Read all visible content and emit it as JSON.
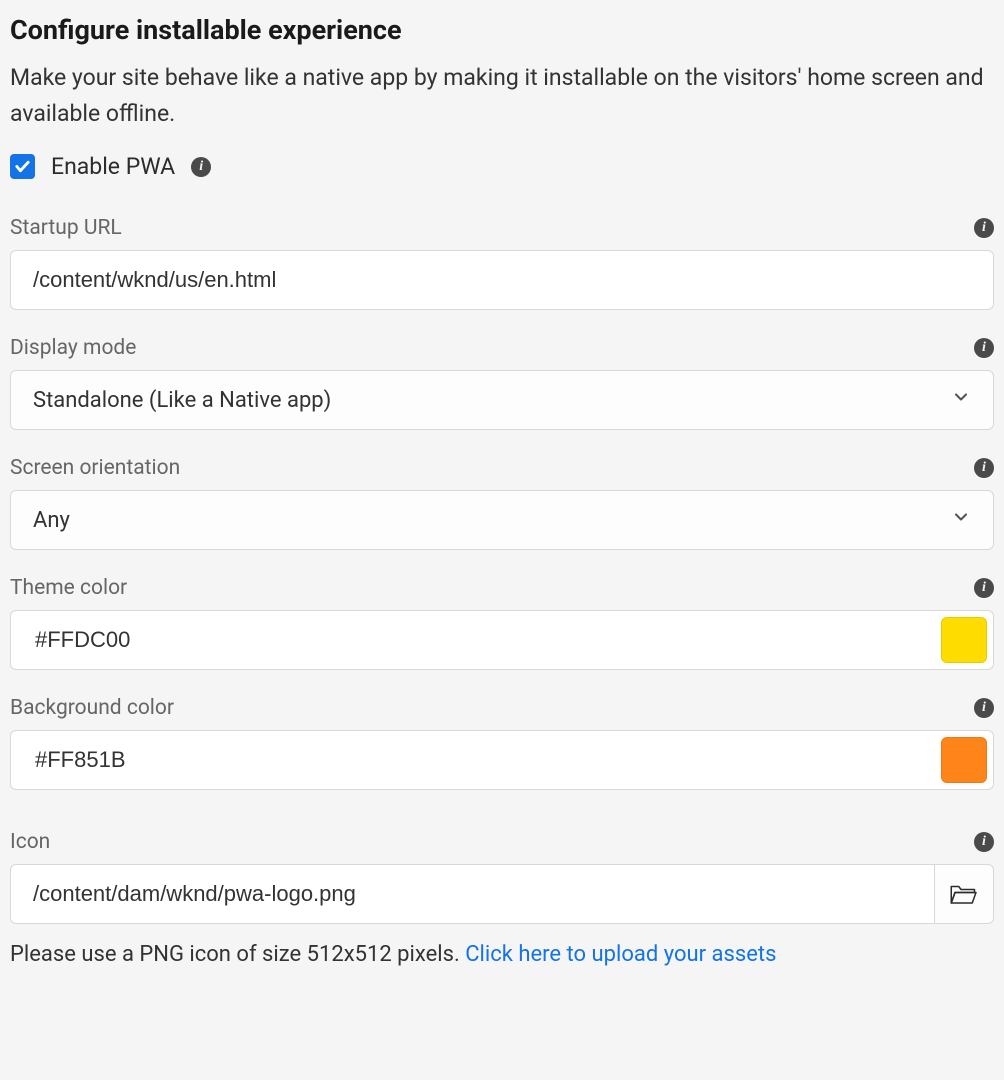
{
  "heading": "Configure installable experience",
  "description": "Make your site behave like a native app by making it installable on the visitors' home screen and available offline.",
  "enable": {
    "label": "Enable PWA",
    "checked": true
  },
  "fields": {
    "startup_url": {
      "label": "Startup URL",
      "value": "/content/wknd/us/en.html"
    },
    "display_mode": {
      "label": "Display mode",
      "value": "Standalone (Like a Native app)"
    },
    "screen_orientation": {
      "label": "Screen orientation",
      "value": "Any"
    },
    "theme_color": {
      "label": "Theme color",
      "value": "#FFDC00"
    },
    "background_color": {
      "label": "Background color",
      "value": "#FF851B"
    },
    "icon": {
      "label": "Icon",
      "value": "/content/dam/wknd/pwa-logo.png"
    }
  },
  "helper": {
    "text": "Please use a PNG icon of size 512x512 pixels. ",
    "link_text": "Click here to upload your assets"
  },
  "colors": {
    "theme_swatch": "#FFDC00",
    "background_swatch": "#FF851B"
  }
}
